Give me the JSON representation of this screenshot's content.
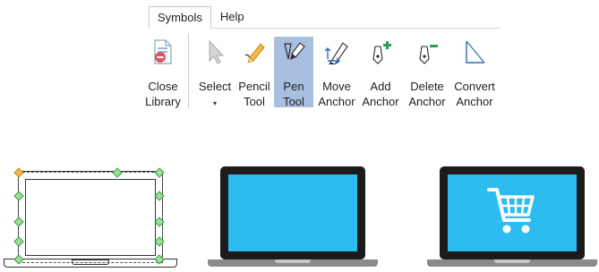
{
  "tabs": [
    {
      "label": "Symbols",
      "active": true
    },
    {
      "label": "Help",
      "active": false
    }
  ],
  "ribbon": {
    "close_library": {
      "line1": "Close",
      "line2": "Library",
      "icon": "close-library-icon"
    },
    "select": {
      "line1": "Select",
      "caret": "▾",
      "icon": "select-arrow-icon"
    },
    "pencil_tool": {
      "line1": "Pencil",
      "line2": "Tool",
      "icon": "pencil-icon"
    },
    "pen_tool": {
      "line1": "Pen",
      "line2": "Tool",
      "icon": "pen-nib-icon",
      "selected": true
    },
    "move_anchor": {
      "line1": "Move",
      "line2": "Anchor",
      "icon": "move-anchor-icon"
    },
    "add_anchor": {
      "line1": "Add",
      "line2": "Anchor",
      "icon": "add-anchor-icon"
    },
    "delete_anchor": {
      "line1": "Delete",
      "line2": "Anchor",
      "icon": "delete-anchor-icon"
    },
    "convert_anchor": {
      "line1": "Convert",
      "line2": "Anchor",
      "icon": "convert-anchor-icon"
    }
  },
  "canvas": {
    "shapes": [
      {
        "name": "laptop-outline",
        "selected": true,
        "screen_color": "#ffffff"
      },
      {
        "name": "laptop-blue-screen",
        "selected": false,
        "screen_color": "#2dbcf0"
      },
      {
        "name": "laptop-shopping-cart",
        "selected": false,
        "screen_color": "#2dbcf0",
        "icon": "shopping-cart-icon"
      }
    ]
  },
  "colors": {
    "selected_button_bg": "#a9bfe0",
    "laptop_frame": "#1b1b1b",
    "laptop_screen_blue": "#2dbcf0",
    "handle_green": "#9be09b"
  }
}
